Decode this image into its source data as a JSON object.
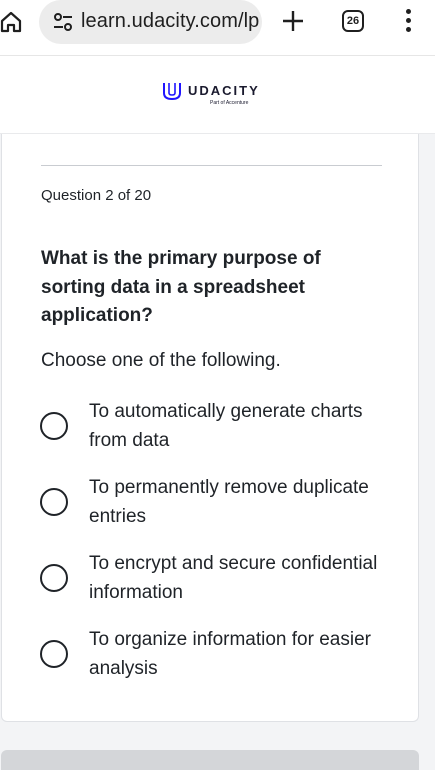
{
  "browser": {
    "url": "learn.udacity.com/lp",
    "tab_count": "26",
    "icons": [
      "home-icon",
      "site-settings-icon",
      "new-tab-plus-icon",
      "tab-switcher-icon",
      "overflow-menu-icon"
    ]
  },
  "header": {
    "logo_text": "UDACITY",
    "logo_subtext": "Part of Accenture",
    "brand_color": "#2015ff"
  },
  "quiz": {
    "counter": "Question 2 of 20",
    "question": "What is the primary purpose of sorting data in a spreadsheet application?",
    "instruction": "Choose one of the following.",
    "options": [
      {
        "label": "To automatically generate charts from data",
        "selected": false
      },
      {
        "label": "To permanently remove duplicate entries",
        "selected": false
      },
      {
        "label": "To encrypt and secure confidential information",
        "selected": false
      },
      {
        "label": "To organize information for easier analysis",
        "selected": false
      }
    ]
  }
}
